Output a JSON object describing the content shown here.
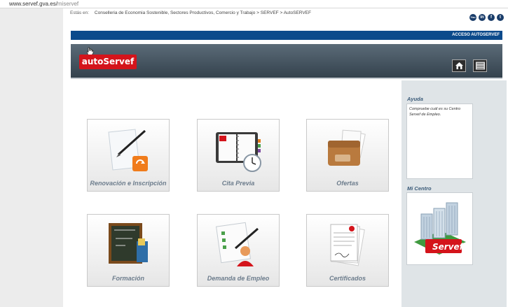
{
  "browser": {
    "url_host": "www.servef.gva.es/",
    "url_path": "miservef"
  },
  "breadcrumb": {
    "label": "Estás en:",
    "items": [
      "Conselleria de Economia Sostenible, Sectores Productivos, Comercio y Trabajo",
      ">",
      "SERVEF",
      ">",
      "AutoSERVEF"
    ]
  },
  "social": [
    "You",
    "in",
    "f",
    "t"
  ],
  "header": {
    "access_label": "ACCESO AUTOSERVEF",
    "logo_text": "autoServef"
  },
  "tiles": [
    {
      "label": "Renovación e Inscripción"
    },
    {
      "label": "Cita Previa"
    },
    {
      "label": "Ofertas"
    },
    {
      "label": "Formación"
    },
    {
      "label": "Demanda de Empleo"
    },
    {
      "label": "Certificados"
    }
  ],
  "sidebar": {
    "help_title": "Ayuda",
    "help_text": "Compruebe cuál es su Centro Servef de Empleo.",
    "center_title": "Mi Centro",
    "center_logo_text": "Servef"
  },
  "colors": {
    "accent_blue": "#0b4a8b",
    "brand_red": "#d4141b",
    "banner_dark": "#3b4a55"
  }
}
